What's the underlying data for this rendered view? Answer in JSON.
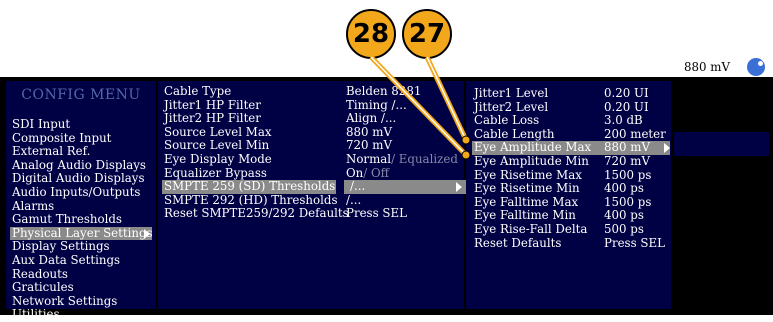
{
  "callouts": {
    "c28": "28",
    "c27": "27"
  },
  "left_menu": {
    "title": "CONFIG MENU",
    "items": [
      {
        "label": "SDI Input"
      },
      {
        "label": "Composite Input"
      },
      {
        "label": "External Ref."
      },
      {
        "label": "Analog Audio Displays"
      },
      {
        "label": "Digital Audio Displays"
      },
      {
        "label": "Audio Inputs/Outputs"
      },
      {
        "label": "Alarms"
      },
      {
        "label": "Gamut Thresholds"
      },
      {
        "label": "Physical Layer Settings",
        "selected": true
      },
      {
        "label": "Display Settings"
      },
      {
        "label": "Aux Data Settings"
      },
      {
        "label": "Readouts"
      },
      {
        "label": "Graticules"
      },
      {
        "label": "Network Settings"
      },
      {
        "label": "Utilities"
      }
    ]
  },
  "mid_menu": {
    "rows": [
      {
        "label": "Cable Type",
        "value": "Belden 8281"
      },
      {
        "label": "Jitter1 HP Filter",
        "value": "Timing /..."
      },
      {
        "label": "Jitter2 HP Filter",
        "value": "Align /..."
      },
      {
        "label": "Source Level Max",
        "value": "880 mV"
      },
      {
        "label": "Source Level Min",
        "value": "720 mV"
      },
      {
        "label": "Eye Display Mode",
        "value": "Normal",
        "value_dim": "/ Equalized"
      },
      {
        "label": "Equalizer Bypass",
        "value": "On",
        "value_dim": "/ Off"
      },
      {
        "label": "SMPTE 259 (SD) Thresholds",
        "value": "/...",
        "selected": true
      },
      {
        "label": "SMPTE 292 (HD) Thresholds",
        "value": "/..."
      },
      {
        "label": "Reset SMPTE259/292 Defaults",
        "value": "Press SEL"
      }
    ]
  },
  "right_menu": {
    "rows": [
      {
        "label": "Jitter1 Level",
        "value": "0.20 UI"
      },
      {
        "label": "Jitter2 Level",
        "value": "0.20 UI"
      },
      {
        "label": "Cable Loss",
        "value": "3.0 dB"
      },
      {
        "label": "Cable Length",
        "value": "200 meter"
      },
      {
        "label": "Eye Amplitude Max",
        "value": "880 mV",
        "selected": true
      },
      {
        "label": "Eye Amplitude Min",
        "value": "720 mV"
      },
      {
        "label": "Eye Risetime Max",
        "value": "1500 ps"
      },
      {
        "label": "Eye Risetime Min",
        "value": "400 ps"
      },
      {
        "label": "Eye Falltime Max",
        "value": "1500 ps"
      },
      {
        "label": "Eye Falltime Min",
        "value": "400 ps"
      },
      {
        "label": "Eye Rise-Fall Delta",
        "value": "500 ps"
      },
      {
        "label": "Reset Defaults",
        "value": "Press SEL"
      }
    ]
  },
  "value_editor": {
    "value": "880 mV",
    "knob_icon": "knob-icon"
  },
  "colors": {
    "panel_bg": "#000044",
    "selection": "#8a8a8a",
    "callout": "#f3a81c",
    "knob": "#3a6fd8"
  }
}
